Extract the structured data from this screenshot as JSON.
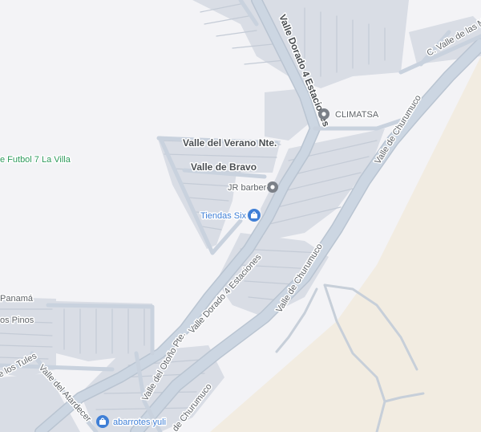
{
  "map": {
    "colors": {
      "land": "#f3f3f6",
      "desert": "#f2ece1",
      "road": "#c9d3df",
      "road_edge": "#b9c4d1",
      "block": "#d6dbe4",
      "label": "#5f6368",
      "park_label": "#2e9a5c",
      "shop": "#3f7fd6",
      "poi_gray": "#7b8088"
    },
    "streets": {
      "valle_dorado_top": "Valle Dorado 4 Estaciones",
      "valle_dorado_bottom": "Valle Dorado 4 Estaciones",
      "valle_verano": "Valle del Verano Nte.",
      "valle_bravo": "Valle de Bravo",
      "churumuco_upper": "Valle de Churumuco",
      "churumuco_middle": "Valle de Churumuco",
      "churumuco_bottom": "de Churumuco",
      "valle_las_ma": "C. Valle de las Ma",
      "valle_otono": "Valle del Otoño Pte.",
      "valle_atardecer": "Valle del Atardecer",
      "los_tules": "e los Tules",
      "panama": "Panamá",
      "los_pinos": "os Pinos"
    },
    "places": {
      "climatsa": "CLIMATSA",
      "jr_barber": "JR barber",
      "tiendas_six": "Tiendas Six",
      "futbol": "e Futbol 7 La Villa",
      "abarrotes": "abarrotes yuli"
    },
    "icons": {
      "pin": "place-pin-icon",
      "shop": "shopping-bag-icon"
    }
  }
}
